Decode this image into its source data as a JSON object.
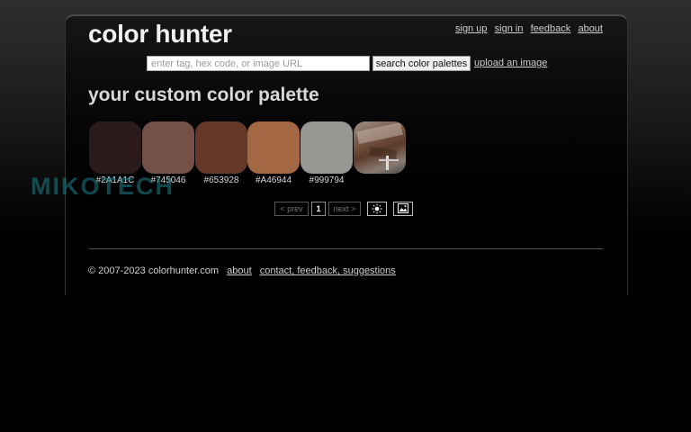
{
  "site": {
    "logo": "color hunter"
  },
  "nav": {
    "links": [
      "sign up",
      "sign in",
      "feedback",
      "about"
    ]
  },
  "search": {
    "placeholder": "enter tag, hex code, or image URL",
    "value": "",
    "button_label": "search color palettes",
    "upload_link": "upload an image"
  },
  "main": {
    "title": "your custom color palette"
  },
  "palette": {
    "swatches": [
      {
        "hex": "#2A1A1C",
        "color": "#2A1A1C"
      },
      {
        "hex": "#745046",
        "color": "#745046"
      },
      {
        "hex": "#653928",
        "color": "#653928"
      },
      {
        "hex": "#A46944",
        "color": "#A46944"
      },
      {
        "hex": "#999794",
        "color": "#999794"
      }
    ],
    "source_image": {
      "icon": "source-photo-thumbnail"
    }
  },
  "watermark": "MIKOTECH",
  "pagination": {
    "prev_label": "< prev",
    "current_page": "1",
    "next_label": "next >",
    "icons": [
      "brightness-icon",
      "image-view-icon"
    ]
  },
  "footer": {
    "copyright": "© 2007-2023 colorhunter.com",
    "about_link": "about",
    "contact_link": "contact, feedback, suggestions"
  }
}
